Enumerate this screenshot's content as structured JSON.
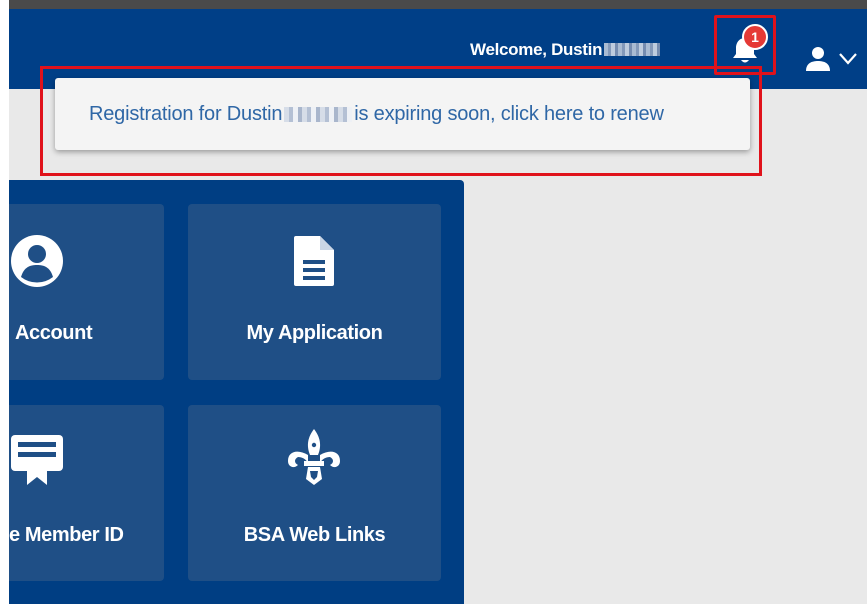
{
  "header": {
    "welcome": "Welcome, Dustin",
    "notification_count": "1"
  },
  "notification": {
    "text_before": "Registration for Dustin",
    "text_after": "is expiring soon, click here to renew"
  },
  "tiles": [
    {
      "label": "Account",
      "icon": "user-circle-icon"
    },
    {
      "label": "My Application",
      "icon": "document-icon"
    },
    {
      "label": "e Member ID",
      "icon": "id-card-icon"
    },
    {
      "label": "BSA Web Links",
      "icon": "bsa-fleur-de-lis-icon"
    }
  ],
  "colors": {
    "header_blue": "#003f87",
    "highlight_red": "#e0121b",
    "link_blue": "#2f67a6",
    "tile_blue": "#1f4f86",
    "badge_red": "#e53935"
  }
}
